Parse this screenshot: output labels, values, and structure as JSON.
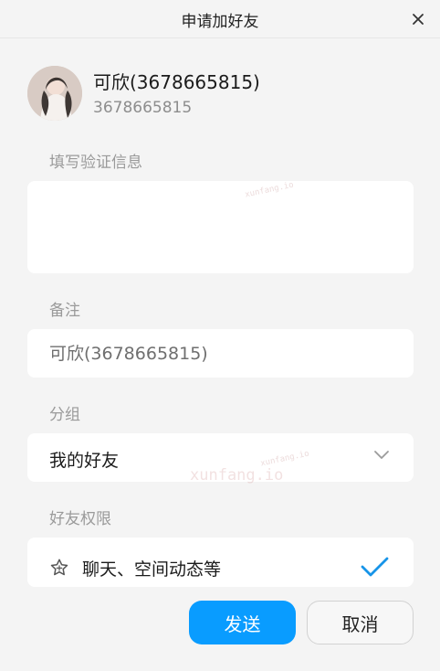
{
  "window": {
    "title": "申请加好友",
    "close_icon": "close-icon"
  },
  "profile": {
    "name": "可欣(3678665815)",
    "uid": "3678665815",
    "avatar_icon": "avatar"
  },
  "verify": {
    "label": "填写验证信息",
    "value": ""
  },
  "remark": {
    "label": "备注",
    "placeholder": "可欣(3678665815)"
  },
  "group": {
    "label": "分组",
    "selected": "我的好友",
    "icon": "chevron-down-icon"
  },
  "permission": {
    "label": "好友权限",
    "option": "聊天、空间动态等",
    "selected": true,
    "icon": "star-icon",
    "check_icon": "check-icon"
  },
  "buttons": {
    "send": "发送",
    "cancel": "取消"
  },
  "watermarks": {
    "small": "xunfang.io",
    "main": "xunfang.io"
  },
  "colors": {
    "accent": "#099cff",
    "background": "#f4f4f4",
    "card": "#ffffff",
    "muted": "#9a9a9a"
  }
}
